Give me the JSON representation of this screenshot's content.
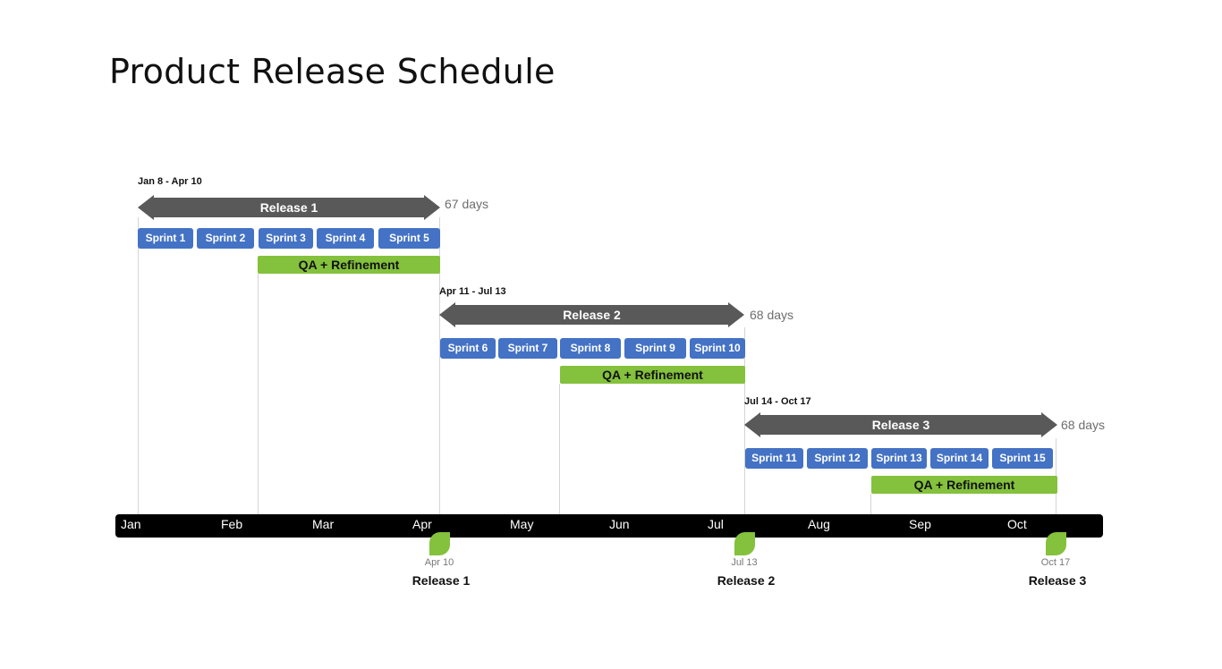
{
  "title": "Product Release Schedule",
  "colors": {
    "release_bar": "#595959",
    "sprint": "#4472c4",
    "qa": "#84c13c",
    "axis": "#000000",
    "milestone": "#84c13c"
  },
  "releases": [
    {
      "name": "Release 1",
      "range": "Jan 8 - Apr 10",
      "duration": "67 days",
      "sprints": [
        "Sprint 1",
        "Sprint 2",
        "Sprint 3",
        "Sprint 4",
        "Sprint 5"
      ],
      "qa_label": "QA + Refinement"
    },
    {
      "name": "Release 2",
      "range": "Apr 11 - Jul 13",
      "duration": "68 days",
      "sprints": [
        "Sprint 6",
        "Sprint 7",
        "Sprint 8",
        "Sprint 9",
        "Sprint 10"
      ],
      "qa_label": "QA + Refinement"
    },
    {
      "name": "Release 3",
      "range": "Jul 14 - Oct 17",
      "duration": "68 days",
      "sprints": [
        "Sprint 11",
        "Sprint 12",
        "Sprint 13",
        "Sprint 14",
        "Sprint 15"
      ],
      "qa_label": "QA + Refinement"
    }
  ],
  "axis": {
    "months": [
      "Jan",
      "Feb",
      "Mar",
      "Apr",
      "May",
      "Jun",
      "Jul",
      "Aug",
      "Sep",
      "Oct"
    ]
  },
  "milestones": [
    {
      "date": "Apr 10",
      "name": "Release 1",
      "icon": "milestone-leaf-icon"
    },
    {
      "date": "Jul 13",
      "name": "Release 2",
      "icon": "milestone-leaf-icon"
    },
    {
      "date": "Oct 17",
      "name": "Release 3",
      "icon": "milestone-leaf-icon"
    }
  ]
}
